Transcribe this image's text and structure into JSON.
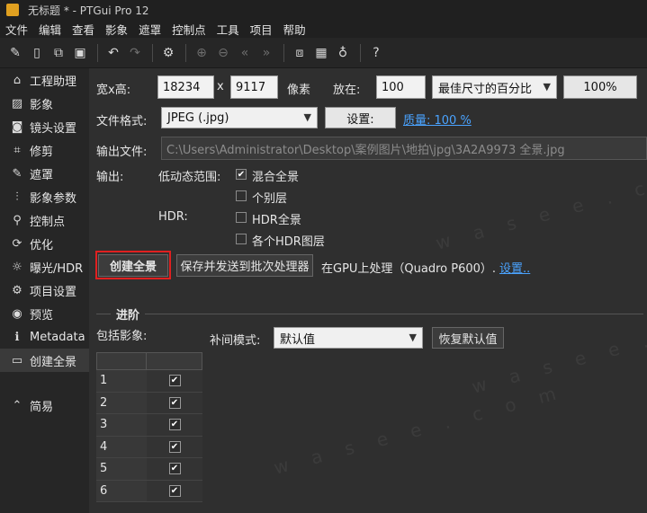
{
  "window": {
    "title": "无标题 * - PTGui Pro 12"
  },
  "menu": [
    "文件",
    "编辑",
    "查看",
    "影象",
    "遮罩",
    "控制点",
    "工具",
    "项目",
    "帮助"
  ],
  "sidebar": {
    "items": [
      {
        "label": "工程助理",
        "icon": "home-icon",
        "glyph": "⌂"
      },
      {
        "label": "影象",
        "icon": "image-icon",
        "glyph": "▨"
      },
      {
        "label": "镜头设置",
        "icon": "camera-icon",
        "glyph": "◙"
      },
      {
        "label": "修剪",
        "icon": "crop-icon",
        "glyph": "⌗"
      },
      {
        "label": "遮罩",
        "icon": "brush-icon",
        "glyph": "✎"
      },
      {
        "label": "影象参数",
        "icon": "sliders-icon",
        "glyph": "⫶"
      },
      {
        "label": "控制点",
        "icon": "control-points-icon",
        "glyph": "⚲"
      },
      {
        "label": "优化",
        "icon": "optimize-icon",
        "glyph": "⟳"
      },
      {
        "label": "曝光/HDR",
        "icon": "sun-icon",
        "glyph": "☼"
      },
      {
        "label": "项目设置",
        "icon": "gear-icon",
        "glyph": "⚙"
      },
      {
        "label": "预览",
        "icon": "eye-icon",
        "glyph": "◉"
      },
      {
        "label": "Metadata",
        "icon": "info-icon",
        "glyph": "ℹ"
      },
      {
        "label": "创建全景",
        "icon": "panorama-icon",
        "glyph": "▭"
      }
    ],
    "simple": {
      "label": "简易",
      "icon": "chevron-up-circle-icon",
      "glyph": "⌃"
    }
  },
  "output_size": {
    "label": "宽x高:",
    "width": "18234",
    "x_sep": "x",
    "height": "9117",
    "unit": "像素",
    "zoom_label": "放在:",
    "zoom_value": "100",
    "zoom_mode": "最佳尺寸的百分比",
    "percent_button": "100%"
  },
  "file_format": {
    "label": "文件格式:",
    "value": "JPEG (.jpg)",
    "settings_button": "设置:",
    "quality_link": "质量: 100 %"
  },
  "output_file": {
    "label": "输出文件:",
    "path": "C:\\Users\\Administrator\\Desktop\\案例图片\\地拍\\jpg\\3A2A9973 全景.jpg"
  },
  "output": {
    "label": "输出:",
    "ldr_label": "低动态范围:",
    "blended": "混合全景",
    "individual": "个别层",
    "hdr_label": "HDR:",
    "hdr_panorama": "HDR全景",
    "hdr_layers": "各个HDR图层"
  },
  "actions": {
    "create_button": "创建全景",
    "batch_button": "保存并发送到批次处理器",
    "gpu_text": "在GPU上处理（Quadro P600）.",
    "gpu_settings_link": "设置.."
  },
  "advanced": {
    "title": "进阶",
    "include_label": "包括影象:",
    "interp_label": "补间模式:",
    "interp_value": "默认值",
    "reset_button": "恢复默认值",
    "rows": [
      "1",
      "2",
      "3",
      "4",
      "5",
      "6"
    ]
  },
  "watermark": "w a s e e . c o m"
}
